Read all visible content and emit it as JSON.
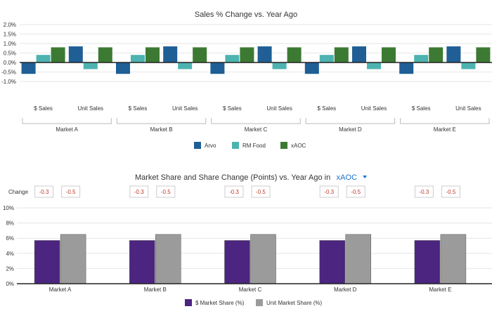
{
  "chart_data": [
    {
      "type": "bar",
      "title": "Sales % Change vs. Year Ago",
      "groups": [
        "Market A",
        "Market B",
        "Market C",
        "Market D",
        "Market E"
      ],
      "categories": [
        "$ Sales",
        "Unit Sales"
      ],
      "series": [
        {
          "name": "Arvo",
          "color": "#1f5f96",
          "values": [
            [
              -0.6,
              0.85
            ],
            [
              -0.6,
              0.85
            ],
            [
              -0.6,
              0.85
            ],
            [
              -0.6,
              0.85
            ],
            [
              -0.6,
              0.85
            ]
          ]
        },
        {
          "name": "RM Food",
          "color": "#4db3b0",
          "values": [
            [
              0.4,
              -0.35
            ],
            [
              0.4,
              -0.35
            ],
            [
              0.4,
              -0.35
            ],
            [
              0.4,
              -0.35
            ],
            [
              0.4,
              -0.35
            ]
          ]
        },
        {
          "name": "xAOC",
          "color": "#3c7a33",
          "values": [
            [
              0.8,
              0.8
            ],
            [
              0.8,
              0.8
            ],
            [
              0.8,
              0.8
            ],
            [
              0.8,
              0.8
            ],
            [
              0.8,
              0.8
            ]
          ]
        }
      ],
      "ylim": [
        -1.0,
        2.0
      ],
      "yticks": [
        "2.0%",
        "1.5%",
        "1.0%",
        "0.5%",
        "0.0%",
        "-0.5%",
        "-1.0%"
      ],
      "grid": true,
      "legend": "bottom"
    },
    {
      "type": "bar",
      "title": "Market Share and Share Change (Points) vs. Year Ago in",
      "dropdown_value": "xAOC",
      "change_label": "Change",
      "categories": [
        "Market A",
        "Market B",
        "Market C",
        "Market D",
        "Market E"
      ],
      "changes": [
        [
          "-0.3",
          "-0.5"
        ],
        [
          "-0.3",
          "-0.5"
        ],
        [
          "-0.3",
          "-0.5"
        ],
        [
          "-0.3",
          "-0.5"
        ],
        [
          "-0.3",
          "-0.5"
        ]
      ],
      "series": [
        {
          "name": "$ Market Share (%)",
          "color": "#4b2580",
          "values": [
            5.7,
            5.7,
            5.7,
            5.7,
            5.7
          ]
        },
        {
          "name": "Unit Market Share (%)",
          "color": "#9b9b9b",
          "values": [
            6.5,
            6.5,
            6.5,
            6.5,
            6.5
          ]
        }
      ],
      "ylim": [
        0,
        10
      ],
      "yticks": [
        "10%",
        "8%",
        "6%",
        "4%",
        "2%",
        "0%"
      ],
      "grid": true,
      "legend": "bottom"
    }
  ]
}
